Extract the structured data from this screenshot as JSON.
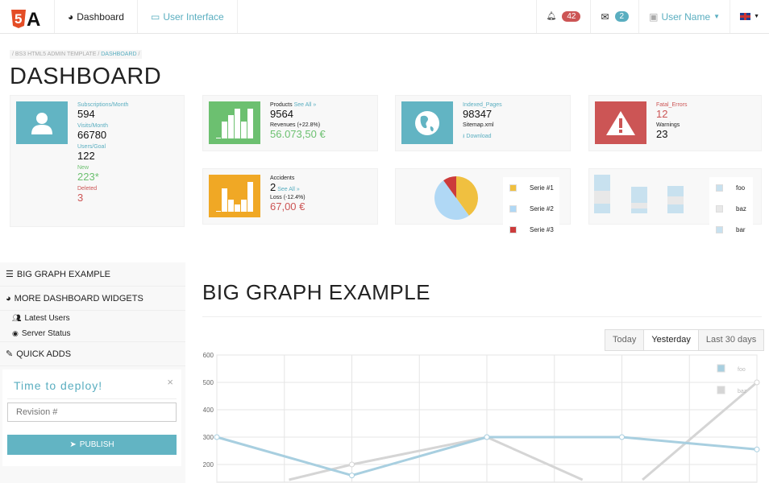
{
  "nav": {
    "logo_text": "HTML5",
    "logo_letter": "A",
    "dashboard": "Dashboard",
    "ui": "User Interface",
    "notifications": "42",
    "messages": "2",
    "user": "User Name",
    "flag": "uk-flag-icon"
  },
  "breadcrumb": {
    "root": "/ BS3 HTML5 ADMIN TEMPLATE /",
    "current": "DASHBOARD",
    "tail": "/"
  },
  "page_title": "DASHBOARD",
  "colors": {
    "teal": "#62b4c3",
    "green": "#6cc070",
    "orange": "#f0a825",
    "red": "#cc5555"
  },
  "stats": {
    "users": {
      "l1": "Subscriptions/Month",
      "v1": "594",
      "l2": "Visits/Month",
      "v2": "66780",
      "l3": "Users/Goal",
      "v3": "122",
      "l4": "New",
      "v4": "223*",
      "l5": "Deleted",
      "v5": "3"
    },
    "products": {
      "label": "Products",
      "see_all": "See All »",
      "value": "9564",
      "rev_label": "Revenues (+22.8%)",
      "rev": "56.073,50 €"
    },
    "pages": {
      "label": "Indexed_Pages",
      "value": "98347",
      "file": "Sitemap.xml",
      "download": "Download"
    },
    "errors": {
      "label": "Fatal_Errors",
      "value": "12",
      "w_label": "Warnings",
      "w_value": "23"
    },
    "accidents": {
      "label": "Accidents",
      "value": "2",
      "see_all": "See All »",
      "loss_label": "Loss (-12.4%)",
      "loss": "67,00 €"
    }
  },
  "pie": {
    "legend": [
      "Serie #1",
      "Serie #2",
      "Serie #3"
    ],
    "values": [
      40,
      50,
      10
    ],
    "colors": [
      "#f0c040",
      "#b0d8f5",
      "#cc3b3b"
    ]
  },
  "minibars": {
    "legend": [
      "foo",
      "baz",
      "bar"
    ]
  },
  "sidebar": {
    "big_graph": "BIG GRAPH EXAMPLE",
    "more": "MORE DASHBOARD WIDGETS",
    "latest": "Latest Users",
    "server": "Server Status",
    "quick": "QUICK ADDS",
    "deploy_title": "Time to deploy!",
    "close": "×",
    "revision_placeholder": "Revision #",
    "publish": "PUBLISH"
  },
  "main": {
    "title": "BIG GRAPH EXAMPLE",
    "ranges": [
      "Today",
      "Yesterday",
      "Last 30 days"
    ],
    "active_range": "Yesterday"
  },
  "chart_data": {
    "type": "line",
    "ylim": [
      0,
      600
    ],
    "yticks": [
      "600",
      "500",
      "400",
      "300",
      "200"
    ],
    "x": [
      0,
      1,
      2,
      3,
      4
    ],
    "grid": true,
    "legend_position": "top-right",
    "series": [
      {
        "name": "foo",
        "values": [
          300,
          160,
          300,
          300,
          255
        ],
        "color": "#a8cfe0"
      },
      {
        "name": "baz",
        "values": [
          80,
          200,
          300,
          80,
          500
        ],
        "color": "#d5d5d5"
      }
    ]
  }
}
